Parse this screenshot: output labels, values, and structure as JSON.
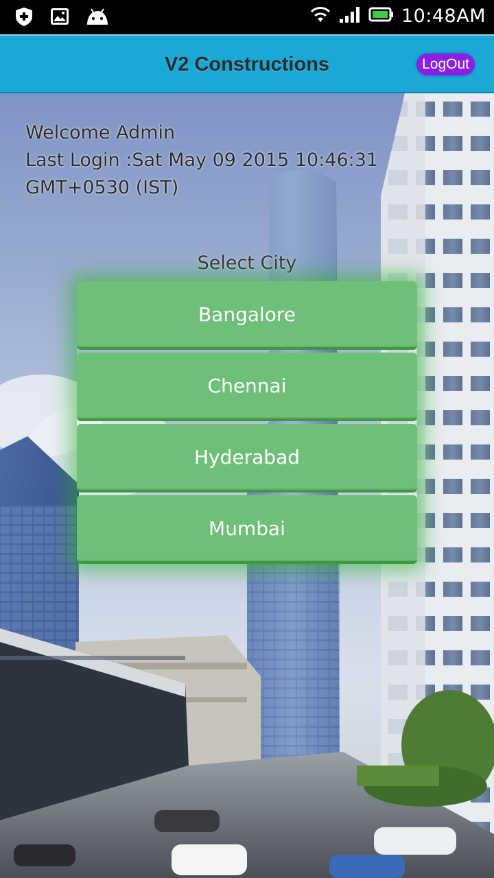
{
  "status_bar": {
    "time": "10:48AM",
    "icons": [
      "shield-plus-icon",
      "image-icon",
      "android-icon",
      "wifi-icon",
      "signal-icon",
      "battery-icon"
    ]
  },
  "header": {
    "title": "V2 Constructions",
    "logout_label": "LogOut"
  },
  "welcome": {
    "greeting": "Welcome Admin",
    "last_login_line1": "Last Login :Sat May 09 2015 10:46:31",
    "last_login_line2": "GMT+0530 (IST)"
  },
  "city_selector": {
    "label": "Select City",
    "cities": [
      "Bangalore",
      "Chennai",
      "Hyderabad",
      "Mumbai"
    ]
  },
  "colors": {
    "appbar": "#1aa8d6",
    "logout": "#8b1fe6",
    "city_button": "#6ec078"
  }
}
